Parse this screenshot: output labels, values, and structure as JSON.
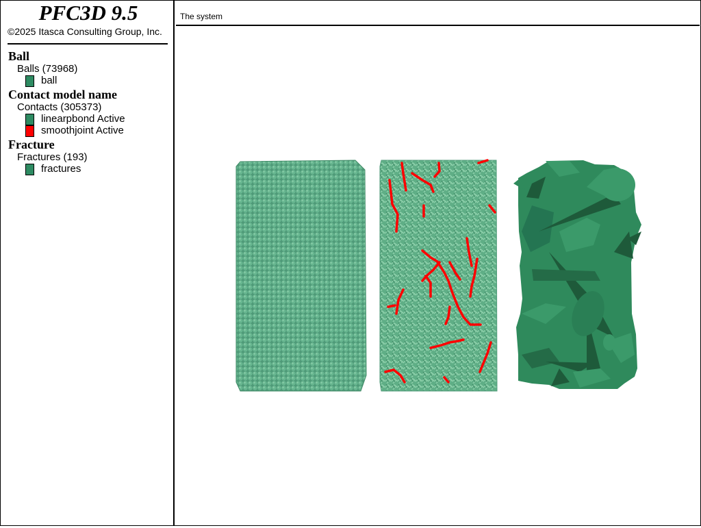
{
  "app": {
    "title": "PFC3D 9.5",
    "copyright": "©2025 Itasca Consulting Group, Inc."
  },
  "legend": {
    "ball": {
      "title": "Ball",
      "subtitle": "Balls (73968)",
      "items": [
        {
          "label": "ball",
          "color": "#2e8b62"
        }
      ]
    },
    "contact": {
      "title": "Contact model name",
      "subtitle": "Contacts (305373)",
      "items": [
        {
          "label": "linearpbond Active",
          "color": "#2e8b62"
        },
        {
          "label": "smoothjoint Active",
          "color": "#ff0000"
        }
      ]
    },
    "fracture": {
      "title": "Fracture",
      "subtitle": "Fractures (193)",
      "items": [
        {
          "label": "fractures",
          "color": "#2e8b62"
        }
      ]
    }
  },
  "plot": {
    "title": "The system"
  },
  "colors": {
    "ball": "#5aae88",
    "contacts": "#6dbc92",
    "smoothjoint": "#ff0000",
    "fractures": "#2f8a5c",
    "fracture_dark": "#1e5a3a"
  }
}
